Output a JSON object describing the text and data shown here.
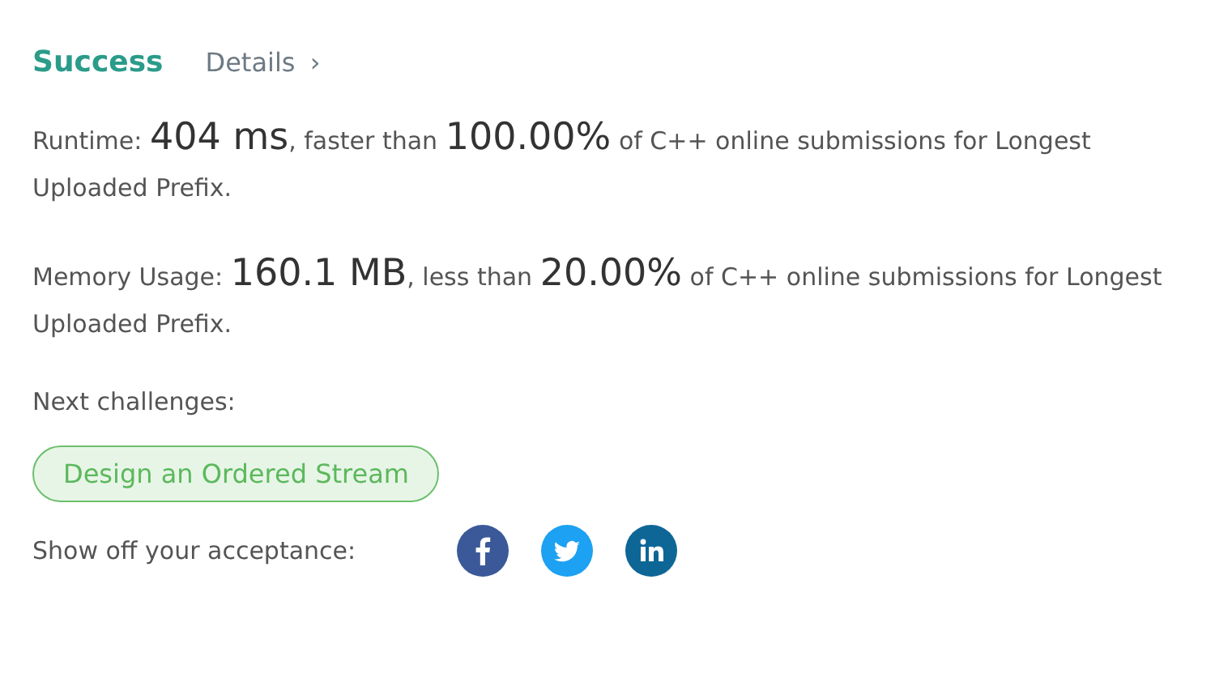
{
  "header": {
    "status": "Success",
    "details_link": "Details",
    "details_arrow": "›"
  },
  "results": [
    {
      "parts": [
        {
          "kind": "text",
          "text": "Runtime: "
        },
        {
          "kind": "figure",
          "text": "404 ms"
        },
        {
          "kind": "text",
          "text": ", faster than "
        },
        {
          "kind": "figure",
          "text": "100.00%"
        },
        {
          "kind": "text",
          "text": " of C++ online submissions for Longest Uploaded Prefix."
        }
      ]
    },
    {
      "parts": [
        {
          "kind": "text",
          "text": "Memory Usage: "
        },
        {
          "kind": "figure",
          "text": "160.1 MB"
        },
        {
          "kind": "text",
          "text": ", less than "
        },
        {
          "kind": "figure",
          "text": "20.00%"
        },
        {
          "kind": "text",
          "text": " of C++ online submissions for Longest Uploaded Prefix."
        }
      ]
    }
  ],
  "next_challenges": {
    "label": "Next challenges:",
    "items": [
      "Design an Ordered Stream"
    ]
  },
  "share": {
    "label": "Show off your acceptance:",
    "networks": [
      {
        "kind": "facebook",
        "color": "#3b5998"
      },
      {
        "kind": "twitter",
        "color": "#1da1f2"
      },
      {
        "kind": "linkedin",
        "color": "#0e6697"
      }
    ]
  }
}
